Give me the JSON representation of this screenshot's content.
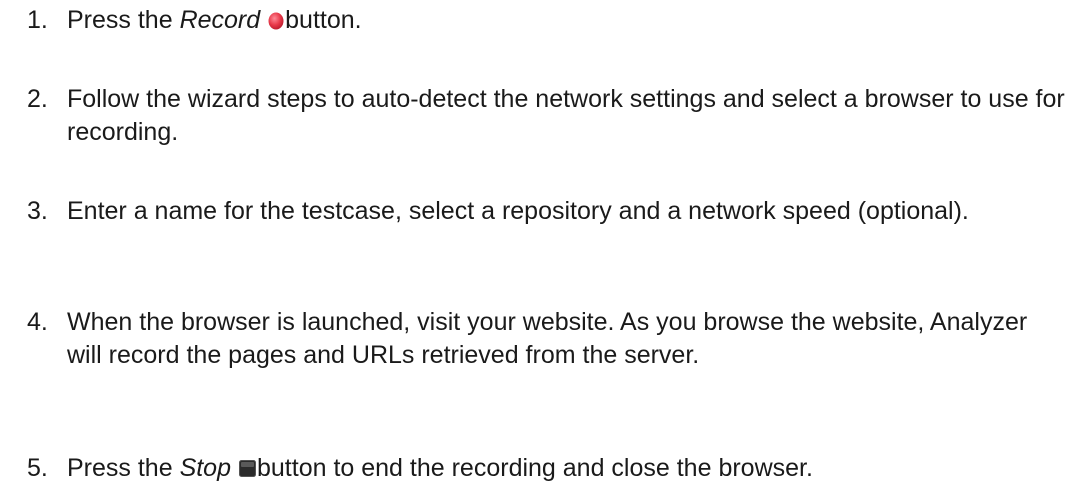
{
  "steps": [
    {
      "number": "1.",
      "before": "Press the ",
      "emphasis": "Record",
      "icon": "record-button-icon",
      "after": "button."
    },
    {
      "number": "2.",
      "text": "Follow the wizard steps to auto-detect the network settings and select a browser to use for recording."
    },
    {
      "number": "3.",
      "text": "Enter a name for the testcase, select a repository and a network speed (optional)."
    },
    {
      "number": "4.",
      "text": "When the browser is launched, visit your website. As you browse the website, Analyzer will record the pages and URLs retrieved from the server."
    },
    {
      "number": "5.",
      "before": "Press the ",
      "emphasis": "Stop",
      "icon": "stop-button-icon",
      "after": "button to end the recording and close the browser."
    }
  ],
  "colors": {
    "text": "#1a1a1a",
    "record_icon": "#e8394a",
    "stop_icon": "#2b2b2b"
  }
}
